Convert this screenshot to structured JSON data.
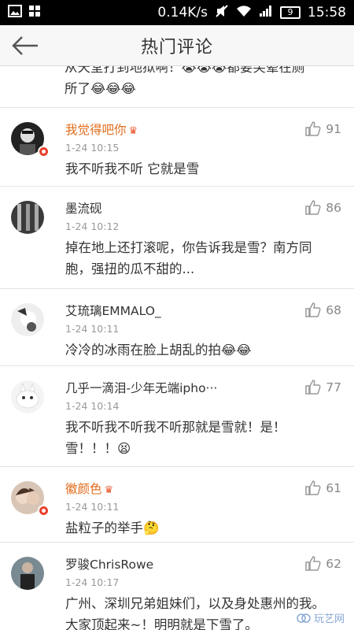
{
  "statusbar": {
    "speed": "0.14K/s",
    "battery": "9",
    "time": "15:58"
  },
  "navbar": {
    "title": "热门评论"
  },
  "partial_comment": {
    "line1": "从天堂打到地狱啊！😭😭😭都要笑晕在厕",
    "line2": "所了😂😂😂"
  },
  "comments": [
    {
      "name": "我觉得吧你",
      "vip": true,
      "time": "1-24 10:15",
      "likes": "91",
      "text": "我不听我不听 它就是雪"
    },
    {
      "name": "墨流砚",
      "vip": false,
      "time": "1-24 10:12",
      "likes": "86",
      "text": "掉在地上还打滚呢，你告诉我是雪？南方同胞，强扭的瓜不甜的..."
    },
    {
      "name": "艾琉璃EMMALO_",
      "vip": false,
      "time": "1-24 10:11",
      "likes": "68",
      "text": "冷冷的冰雨在脸上胡乱的拍😂😂"
    },
    {
      "name": "几乎一滴泪-少年无端ipho···",
      "vip": false,
      "time": "1-24 10:14",
      "likes": "77",
      "text": "我不听我不听我不听那就是雪就！是！雪！！！😫"
    },
    {
      "name": "徽颜色",
      "vip": true,
      "time": "1-24 10:11",
      "likes": "61",
      "text": "盐粒子的举手🤔"
    },
    {
      "name": "罗骏ChrisRowe",
      "vip": false,
      "time": "1-24 10:17",
      "likes": "62",
      "text": "广州、深圳兄弟姐妹们，以及身处惠州的我。大家顶起来~！明明就是下雪了。"
    }
  ],
  "watermark": "玩艺网"
}
